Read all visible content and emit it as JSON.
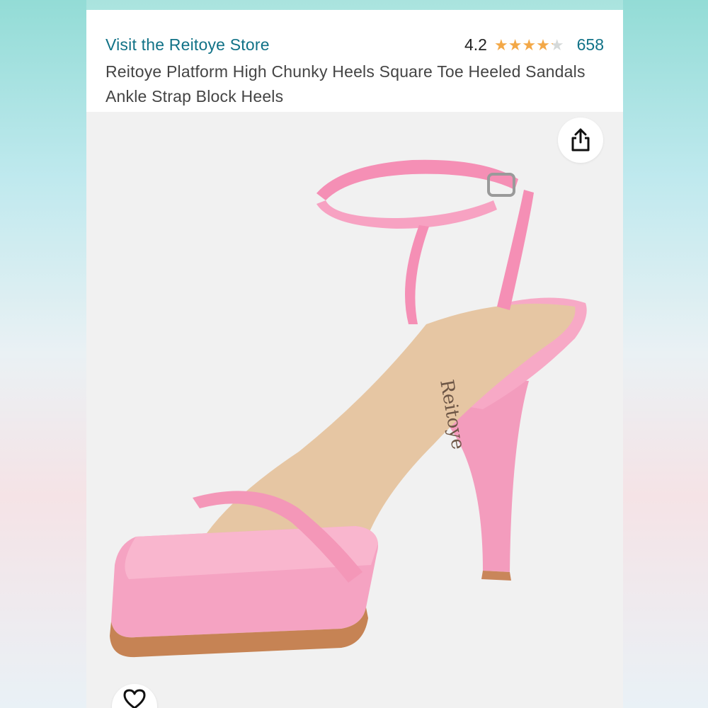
{
  "store": {
    "link_label": "Visit the Reitoye Store"
  },
  "rating": {
    "value": "4.2",
    "stars_filled": 4.2,
    "stars_max": 5,
    "review_count": "658"
  },
  "product": {
    "title": "Reitoye Platform High Chunky Heels Square Toe Heeled Sandals Ankle Strap Block Heels",
    "insole_logo": "Reitoye"
  },
  "icons": {
    "share": "share-icon",
    "favorite": "heart-icon",
    "star": "star-icon"
  },
  "colors": {
    "link": "#117287",
    "star": "#f3a847",
    "shoe_pink": "#f4a7c2",
    "insole": "#e3c7a4"
  }
}
